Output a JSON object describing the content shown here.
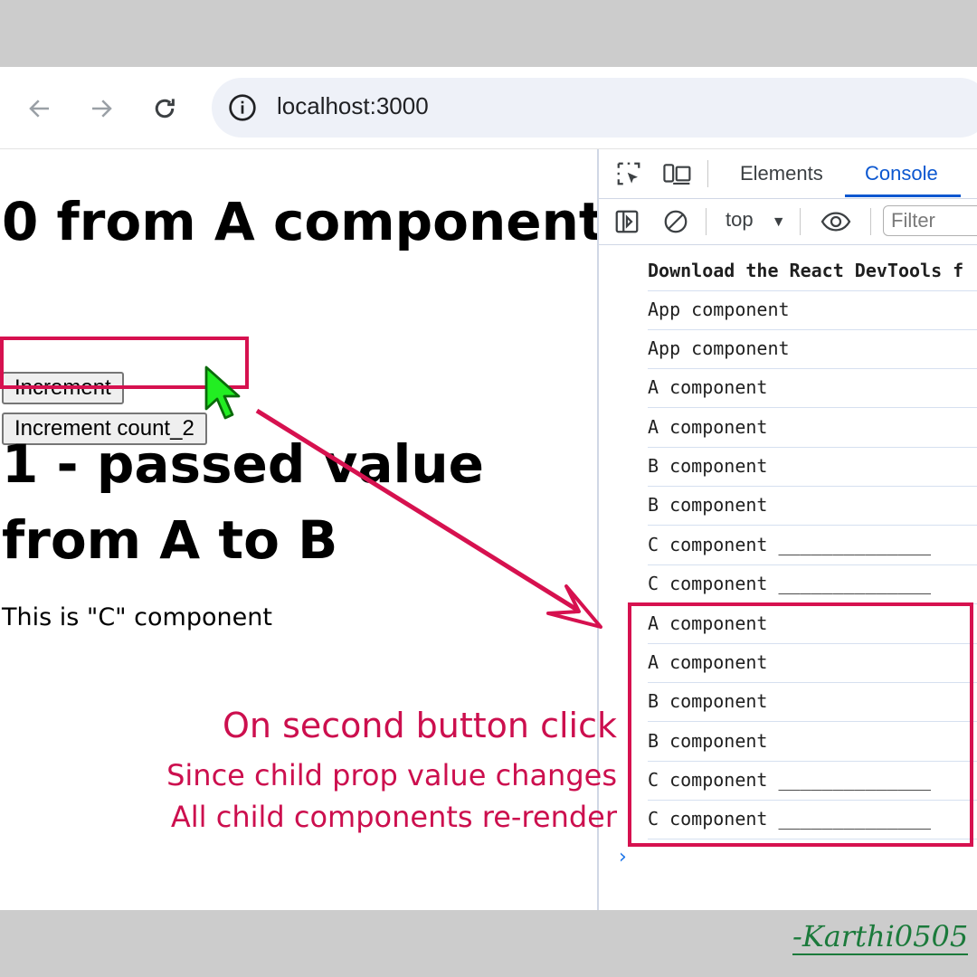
{
  "browser": {
    "url": "localhost:3000",
    "icons": {
      "back": "arrow-left-icon",
      "forward": "arrow-right-icon",
      "reload": "reload-icon",
      "site_info": "info-icon"
    }
  },
  "page": {
    "heading_a": "0 from A component",
    "increment_button": "Increment",
    "increment_count2_button": "Increment count_2",
    "heading_b": "1 - passed value from A to B",
    "c_text": "This is \"C\" component"
  },
  "devtools": {
    "tabs": [
      "Elements",
      "Console"
    ],
    "active_tab": "Console",
    "context": "top",
    "filter_placeholder": "Filter",
    "logs": [
      "Download the React DevTools f",
      "App component",
      "App component",
      "A component",
      "A component",
      "B component",
      "B component",
      "C component ______________",
      "C component ______________",
      "A component",
      "A component",
      "B component",
      "B component",
      "C component ______________",
      "C component ______________"
    ],
    "prompt": "›"
  },
  "annotation": {
    "title": "On second button click",
    "line1": "Since child prop value changes",
    "line2": "All child components re-render",
    "color": "#d6114f"
  },
  "signature": "-Karthi0505"
}
